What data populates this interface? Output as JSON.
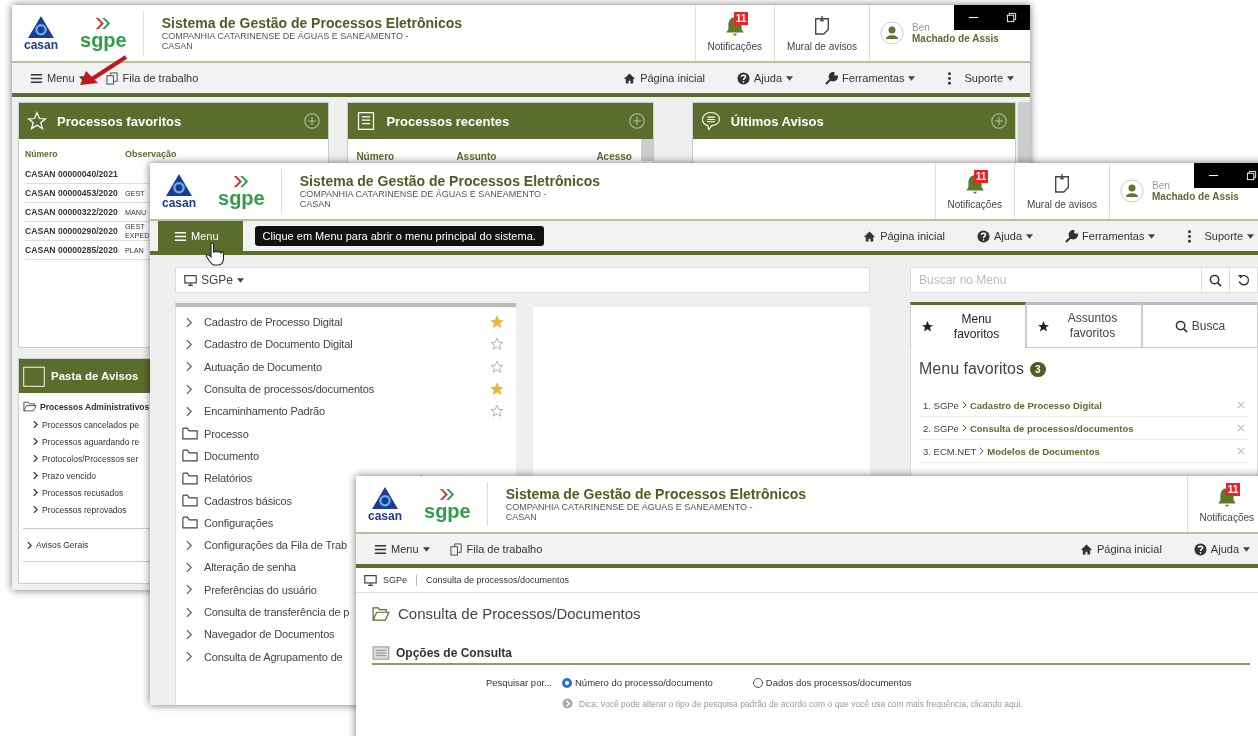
{
  "windows": [
    {
      "kind": "dashboard",
      "header": {
        "logo_text": "casan",
        "product": "sgpe",
        "app_title": "Sistema de Gestão de Processos Eletrônicos",
        "company": "COMPANHIA CATARINENSE DE ÁGUAS E SANEAMENTO - CASAN",
        "notifications": {
          "label": "Notificações",
          "count": "11"
        },
        "mural": "Mural de avisos",
        "user": {
          "greeting": "Ben",
          "name": "Machado de Assis"
        },
        "window_controls": true
      },
      "nav": {
        "left": [
          {
            "label": "Menu",
            "kind": "menu",
            "dropdown": true,
            "active": false
          },
          {
            "label": "Fila de trabalho",
            "kind": "queue",
            "dropdown": false,
            "active": false
          }
        ],
        "right": [
          {
            "label": "Página inicial",
            "kind": "home",
            "dropdown": false
          },
          {
            "label": "Ajuda",
            "kind": "help",
            "dropdown": true
          },
          {
            "label": "Ferramentas",
            "kind": "tools",
            "dropdown": true
          },
          {
            "label": "Suporte",
            "kind": "support",
            "dropdown": true
          }
        ]
      },
      "favorites_panel": {
        "title": "Processos favoritos",
        "columns": [
          "Número",
          "Observação"
        ],
        "rows": [
          {
            "number": "CASAN 00000040/2021"
          },
          {
            "number": "CASAN 00000453/2020",
            "note": "GEST"
          },
          {
            "number": "CASAN 00000322/2020",
            "note": "MANU"
          },
          {
            "number": "CASAN 00000290/2020",
            "note": "GEST EXPED"
          },
          {
            "number": "CASAN 00000285/2020",
            "note": "PLAN"
          }
        ]
      },
      "recent_panel": {
        "title": "Processos recentes",
        "columns": [
          "Número",
          "Assunto",
          "Acesso"
        ]
      },
      "notices_panel": {
        "title": "Últimos Avisos"
      },
      "folder_panel": {
        "title": "Pasta de Avisos",
        "group": "Processos Administrativos",
        "items": [
          "Processos cancelados pe",
          "Processos aguardando re",
          "Protocolos/Processos ser",
          "Prazo vencido",
          "Processos recusados",
          "Processos reprovados"
        ],
        "general": "Avisos Gerais"
      }
    },
    {
      "kind": "menu",
      "header": {
        "logo_text": "casan",
        "product": "sgpe",
        "app_title": "Sistema de Gestão de Processos Eletrônicos",
        "company": "COMPANHIA CATARINENSE DE ÁGUAS E SANEAMENTO - CASAN",
        "notifications": {
          "label": "Notificações",
          "count": "11"
        },
        "mural": "Mural de avisos",
        "user": {
          "greeting": "Ben",
          "name": "Machado de Assis"
        },
        "window_controls": true
      },
      "nav": {
        "left": [
          {
            "label": "Menu",
            "kind": "menu",
            "dropdown": false,
            "active": true
          }
        ],
        "tooltip": "Clique em Menu para abrir o menu principal do sistema.",
        "right": [
          {
            "label": "Página inicial",
            "kind": "home",
            "dropdown": false
          },
          {
            "label": "Ajuda",
            "kind": "help",
            "dropdown": true
          },
          {
            "label": "Ferramentas",
            "kind": "tools",
            "dropdown": true
          },
          {
            "label": "Suporte",
            "kind": "support",
            "dropdown": true
          }
        ]
      },
      "system_select": "SGPe",
      "menu_items": [
        {
          "label": "Cadastro de Processo Digital",
          "kind": "link",
          "favorite": true
        },
        {
          "label": "Cadastro de Documento Digital",
          "kind": "link",
          "favorite": false
        },
        {
          "label": "Autuação de Documento",
          "kind": "link",
          "favorite": false
        },
        {
          "label": "Consulta de processos/documentos",
          "kind": "link",
          "favorite": true
        },
        {
          "label": "Encaminhamento Padrão",
          "kind": "link",
          "favorite": false
        },
        {
          "label": "Processo",
          "kind": "folder"
        },
        {
          "label": "Documento",
          "kind": "folder"
        },
        {
          "label": "Relatórios",
          "kind": "folder"
        },
        {
          "label": "Cadastros básicos",
          "kind": "folder"
        },
        {
          "label": "Configurações",
          "kind": "folder"
        },
        {
          "label": "Configurações da Fila de Trab",
          "kind": "link"
        },
        {
          "label": "Alteração de senha",
          "kind": "link"
        },
        {
          "label": "Preferências do usuário",
          "kind": "link"
        },
        {
          "label": "Consulta de transferência de p",
          "kind": "link"
        },
        {
          "label": "Navegador de Documentos",
          "kind": "link"
        },
        {
          "label": "Consulta de Agrupamento de",
          "kind": "link"
        }
      ],
      "menu_search": {
        "placeholder": "Buscar no Menu"
      },
      "tabs": [
        {
          "label": "Menu favoritos",
          "kind": "star",
          "selected": true
        },
        {
          "label": "Assuntos favoritos",
          "kind": "star",
          "selected": false
        },
        {
          "label": "Busca",
          "kind": "search",
          "selected": false
        }
      ],
      "favorites": {
        "title": "Menu favoritos",
        "count": "3",
        "items": [
          {
            "number": "1.",
            "system": "SGPe",
            "label": "Cadastro de Processo Digital"
          },
          {
            "number": "2.",
            "system": "SGPe",
            "label": "Consulta de processos/documentos"
          },
          {
            "number": "3.",
            "system": "ECM.NET",
            "label": "Modelos de Documentos"
          }
        ]
      }
    },
    {
      "kind": "query",
      "header": {
        "logo_text": "casan",
        "product": "sgpe",
        "app_title": "Sistema de Gestão de Processos Eletrônicos",
        "company": "COMPANHIA CATARINENSE DE ÁGUAS E SANEAMENTO - CASAN",
        "notifications": {
          "label": "Notificações",
          "count": "11"
        },
        "window_controls": false
      },
      "nav": {
        "left": [
          {
            "label": "Menu",
            "kind": "menu",
            "dropdown": true,
            "active": false
          },
          {
            "label": "Fila de trabalho",
            "kind": "queue",
            "dropdown": false,
            "active": false
          }
        ],
        "right": [
          {
            "label": "Página inicial",
            "kind": "home",
            "dropdown": false
          },
          {
            "label": "Ajuda",
            "kind": "help",
            "dropdown": true
          }
        ]
      },
      "breadcrumb": [
        "SGPe",
        "Consulta de processos/documentos"
      ],
      "page_title": "Consulta de Processos/Documentos",
      "section_title": "Opções de Consulta",
      "search_by": {
        "label": "Pesquisar por...",
        "options": [
          {
            "label": "Número do processo/documento",
            "selected": true
          },
          {
            "label": "Dados dos processos/documentos",
            "selected": false
          }
        ]
      },
      "tip": "Dica: você pode alterar o tipo de pesquisa padrão de acordo com o que você usa com mais frequência, clicando aqui."
    }
  ]
}
